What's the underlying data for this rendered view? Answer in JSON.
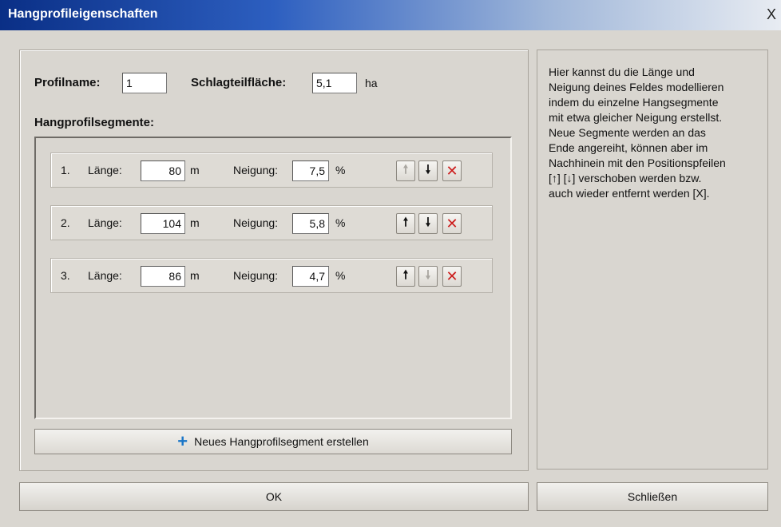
{
  "window": {
    "title": "Hangprofileigenschaften",
    "close_glyph": "X"
  },
  "form": {
    "profilname_label": "Profilname:",
    "profilname_value": "1",
    "schlagteilflaeche_label": "Schlagteilfläche:",
    "schlagteilflaeche_value": "5,1",
    "schlagteilflaeche_unit": "ha",
    "segments_label": "Hangprofilsegmente:"
  },
  "segment_labels": {
    "laenge": "Länge:",
    "laenge_unit": "m",
    "neigung": "Neigung:",
    "neigung_unit": "%"
  },
  "segments": [
    {
      "index": "1.",
      "laenge": "80",
      "neigung": "7,5",
      "up_enabled": false,
      "down_enabled": true
    },
    {
      "index": "2.",
      "laenge": "104",
      "neigung": "5,8",
      "up_enabled": true,
      "down_enabled": true
    },
    {
      "index": "3.",
      "laenge": "86",
      "neigung": "4,7",
      "up_enabled": true,
      "down_enabled": false
    }
  ],
  "buttons": {
    "up_glyph": "🠕",
    "down_glyph": "🠗",
    "delete_glyph": "✕",
    "add_icon": "+",
    "add_label": "Neues Hangprofilsegment erstellen",
    "ok_label": "OK",
    "close_label": "Schließen"
  },
  "help_text": "Hier kannst du die Länge und\nNeigung deines Feldes modellieren\nindem du einzelne Hangsegmente\nmit etwa gleicher Neigung erstellst.\nNeue Segmente werden an das\nEnde angereiht, können aber im\nNachhinein mit den Positionspfeilen\n[↑] [↓] verschoben werden bzw.\nauch wieder entfernt werden [X].",
  "colors": {
    "accent_delete": "#cc1c1c",
    "add_icon": "#1a76c8",
    "title_bar": "#0a2f86"
  }
}
